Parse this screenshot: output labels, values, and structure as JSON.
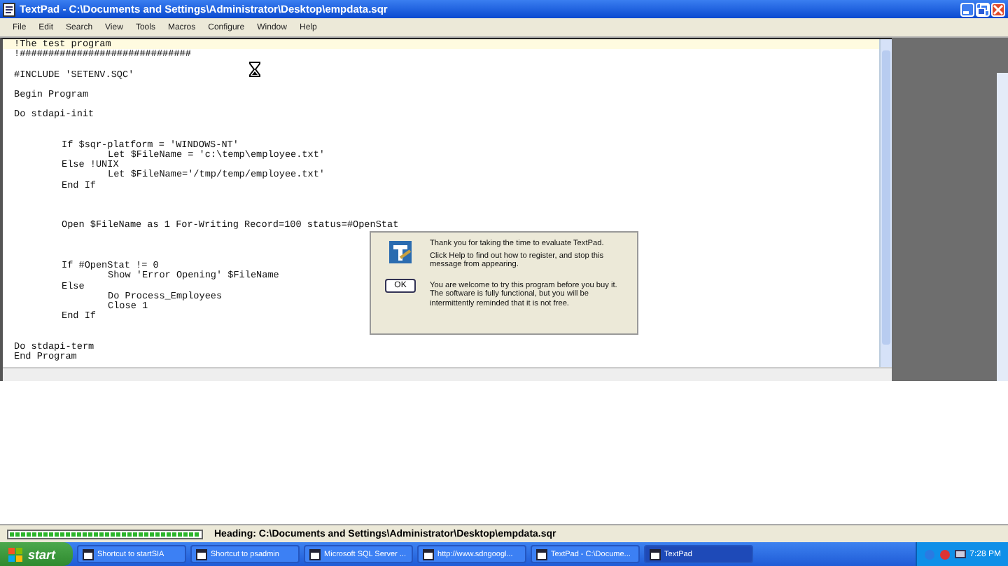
{
  "window": {
    "title": "TextPad - C:\\Documents and Settings\\Administrator\\Desktop\\empdata.sqr"
  },
  "menu": [
    "File",
    "Edit",
    "Search",
    "View",
    "Tools",
    "Macros",
    "Configure",
    "Window",
    "Help"
  ],
  "editor": {
    "lines": [
      {
        "kind": "top",
        "text": "!The test program"
      },
      {
        "kind": "top",
        "text": "!##############################"
      },
      {
        "kind": "blank"
      },
      {
        "kind": "top",
        "text": "#INCLUDE 'SETENV.SQC'"
      },
      {
        "kind": "blank"
      },
      {
        "kind": "top",
        "text": "Begin Program"
      },
      {
        "kind": "blank"
      },
      {
        "kind": "top",
        "text": "Do stdapi-init"
      },
      {
        "kind": "blank"
      },
      {
        "kind": "blank"
      },
      {
        "kind": "tab1",
        "text": "If $sqr-platform = 'WINDOWS-NT'"
      },
      {
        "kind": "tab2",
        "text": "Let $FileName = 'c:\\temp\\employee.txt'"
      },
      {
        "kind": "tab1",
        "text": "Else !UNIX"
      },
      {
        "kind": "tab2",
        "text": "Let $FileName='/tmp/temp/employee.txt'"
      },
      {
        "kind": "tab1",
        "text": "End If"
      },
      {
        "kind": "blank"
      },
      {
        "kind": "blank"
      },
      {
        "kind": "blank"
      },
      {
        "kind": "tab1",
        "text": "Open $FileName as 1 For-Writing Record=100 status=#OpenStat"
      },
      {
        "kind": "blank"
      },
      {
        "kind": "blank"
      },
      {
        "kind": "blank"
      },
      {
        "kind": "tab1",
        "text": "If #OpenStat != 0"
      },
      {
        "kind": "tab2",
        "text": "Show 'Error Opening' $FileName"
      },
      {
        "kind": "tab1",
        "text": "Else"
      },
      {
        "kind": "tab2",
        "text": "Do Process_Employees"
      },
      {
        "kind": "tab2",
        "text": "Close 1"
      },
      {
        "kind": "tab1",
        "text": "End If"
      },
      {
        "kind": "blank"
      },
      {
        "kind": "blank"
      },
      {
        "kind": "top",
        "text": "Do stdapi-term"
      },
      {
        "kind": "top",
        "text": "End Program"
      }
    ]
  },
  "dialog": {
    "message": "Thank you for taking the time to evaluate TextPad.",
    "help": "Click Help to find out how to register, and stop this message from appearing.",
    "note": "You are welcome to try this program before you buy it. The software is fully functional, but you will be intermittently reminded that it is not free.",
    "button": "OK"
  },
  "status_bar": {
    "progress": {
      "level": 1
    },
    "text": "Heading: C:\\Documents and Settings\\Administrator\\Desktop\\empdata.sqr"
  },
  "taskbar": {
    "start": "start",
    "items": [
      {
        "label": "Shortcut to startSIA",
        "selected": false
      },
      {
        "label": "Shortcut to psadmin",
        "selected": false
      },
      {
        "label": "Microsoft SQL Server ...",
        "selected": false
      },
      {
        "label": "http://www.sdngoogl...",
        "selected": false
      },
      {
        "label": "TextPad - C:\\Docume...",
        "selected": false
      },
      {
        "label": "TextPad",
        "selected": true
      }
    ],
    "clock": "7:28 PM"
  }
}
